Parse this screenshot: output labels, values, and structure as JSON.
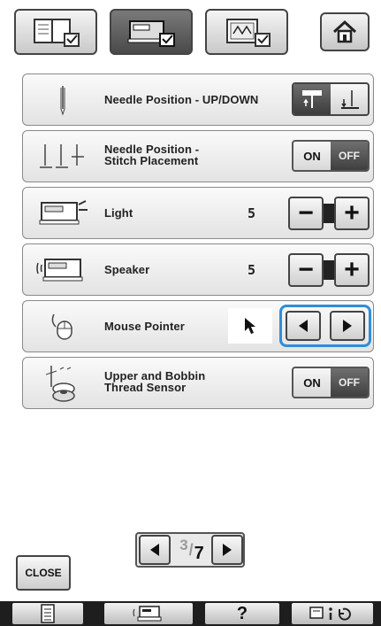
{
  "top_tabs": [
    {
      "icon": "book-settings-icon",
      "active": false
    },
    {
      "icon": "machine-settings-icon",
      "active": true
    },
    {
      "icon": "embroidery-settings-icon",
      "active": false
    }
  ],
  "home": {
    "icon": "home-icon"
  },
  "settings": {
    "needle_position_updown": {
      "label": "Needle Position - UP/DOWN"
    },
    "needle_position_stitch": {
      "label_line1": "Needle Position -",
      "label_line2": "Stitch Placement",
      "on_label": "ON",
      "off_label": "OFF"
    },
    "light": {
      "label": "Light",
      "value": "5",
      "minus": "−",
      "plus": "+"
    },
    "speaker": {
      "label": "Speaker",
      "value": "5",
      "minus": "−",
      "plus": "+"
    },
    "mouse_pointer": {
      "label": "Mouse Pointer"
    },
    "thread_sensor": {
      "label_line1": "Upper and Bobbin",
      "label_line2": "Thread Sensor",
      "on_label": "ON",
      "off_label": "OFF"
    }
  },
  "pager": {
    "current": "3",
    "total": "7"
  },
  "close": {
    "label": "CLOSE"
  },
  "bottom_bar": {
    "help_label": "?"
  },
  "colors": {
    "highlight": "#2f8ed8",
    "bottom_bar": "#1e1e1e",
    "dark_toggle": "#4a4a4a"
  }
}
